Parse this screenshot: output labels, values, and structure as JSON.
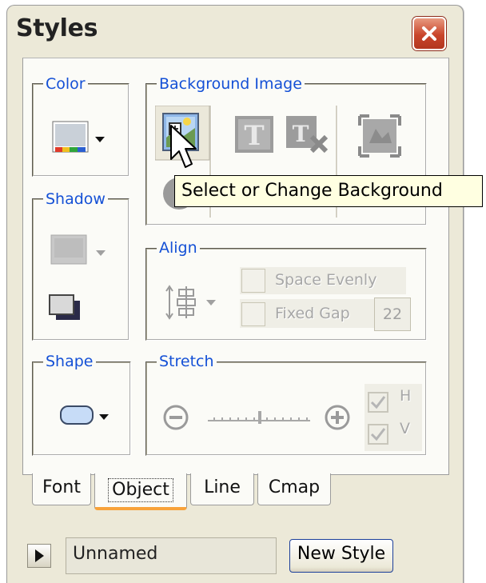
{
  "window": {
    "title": "Styles"
  },
  "groups": {
    "color": "Color",
    "shadow": "Shadow",
    "shape": "Shape",
    "background_image": "Background Image",
    "align": "Align",
    "stretch": "Stretch"
  },
  "align": {
    "space_evenly_label": "Space Evenly",
    "fixed_gap_label": "Fixed Gap",
    "fixed_gap_value": "22"
  },
  "stretch": {
    "h_label": "H",
    "v_label": "V"
  },
  "tooltip": "Select or Change Background",
  "tabs": [
    {
      "label": "Font"
    },
    {
      "label": "Object",
      "active": true
    },
    {
      "label": "Line"
    },
    {
      "label": "Cmap"
    }
  ],
  "footer": {
    "style_name": "Unnamed",
    "new_style_label": "New Style"
  },
  "colors": {
    "group_label": "#1450d6",
    "window_bg": "#ece9d8",
    "close_button": "#c9452b",
    "tooltip_bg": "#ffffe1",
    "active_tab_marker": "#f8a23a"
  }
}
